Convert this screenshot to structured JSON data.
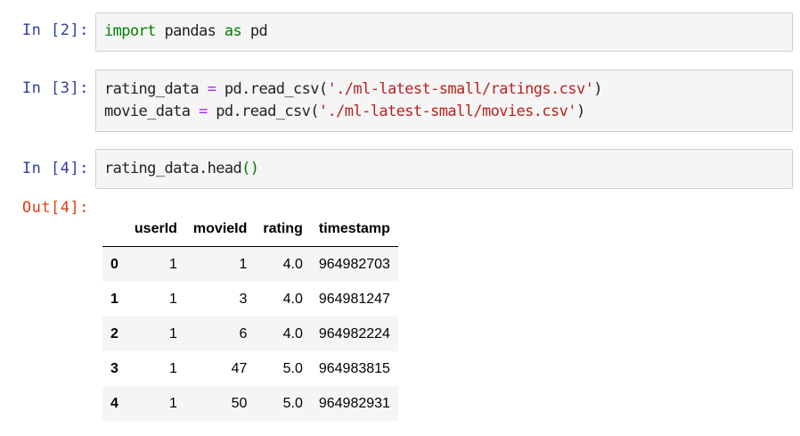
{
  "cells": [
    {
      "prompt": "In [2]:",
      "code": {
        "l1_kw1": "import",
        "l1_mid": " pandas ",
        "l1_kw2": "as",
        "l1_end": " pd"
      }
    },
    {
      "prompt": "In [3]:",
      "code": {
        "l1_a": "rating_data ",
        "l1_eq": "=",
        "l1_b": " pd.read_csv(",
        "l1_str": "'./ml-latest-small/ratings.csv'",
        "l1_c": ")",
        "l2_a": "movie_data ",
        "l2_eq": "=",
        "l2_b": " pd.read_csv(",
        "l2_str": "'./ml-latest-small/movies.csv'",
        "l2_c": ")"
      }
    },
    {
      "prompt": "In [4]:",
      "code": {
        "l1_a": "rating_data.head",
        "l1_par": "()"
      },
      "out_prompt": "Out[4]:",
      "table": {
        "columns": [
          "",
          "userId",
          "movieId",
          "rating",
          "timestamp"
        ],
        "rows": [
          [
            "0",
            "1",
            "1",
            "4.0",
            "964982703"
          ],
          [
            "1",
            "1",
            "3",
            "4.0",
            "964981247"
          ],
          [
            "2",
            "1",
            "6",
            "4.0",
            "964982224"
          ],
          [
            "3",
            "1",
            "47",
            "5.0",
            "964983815"
          ],
          [
            "4",
            "1",
            "50",
            "5.0",
            "964982931"
          ]
        ]
      }
    }
  ],
  "colors": {
    "in_prompt": "#303f9f",
    "out_prompt": "#d84315",
    "keyword": "#008000",
    "operator": "#aa22ff",
    "string": "#ba2121",
    "cell_bg": "#f5f5f5",
    "cell_border": "#cfcfcf"
  }
}
